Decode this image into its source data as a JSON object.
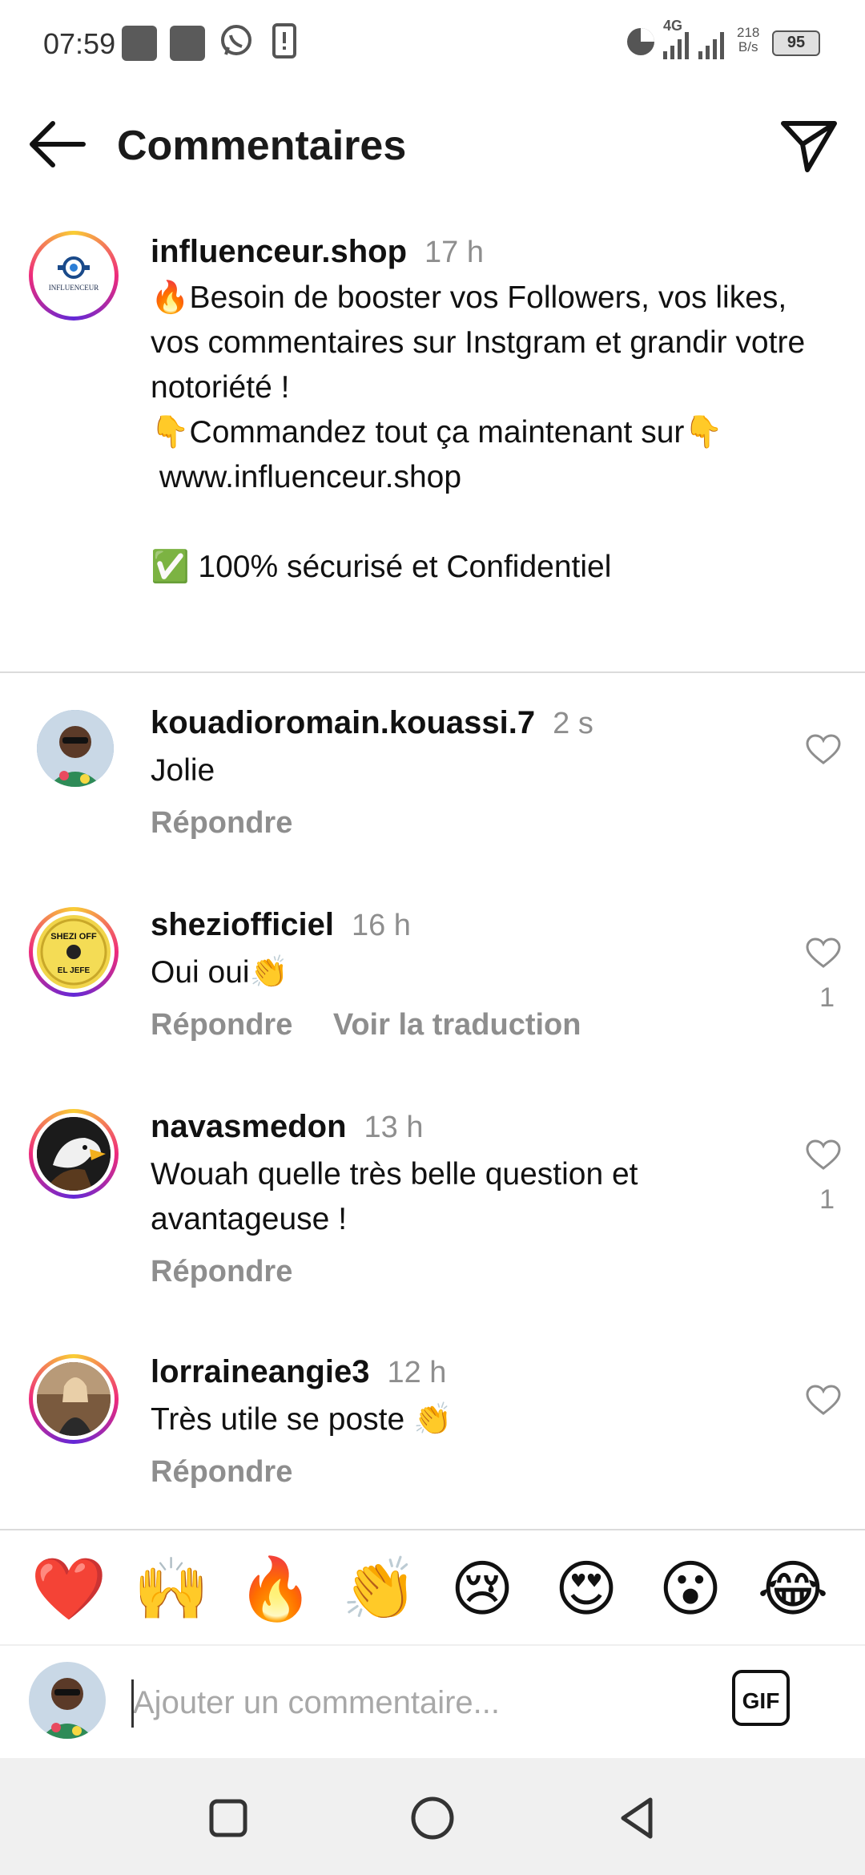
{
  "status_bar": {
    "time": "07:59",
    "network": "4G",
    "speed_value": "218",
    "speed_unit": "B/s",
    "battery": "95"
  },
  "header": {
    "title": "Commentaires"
  },
  "caption": {
    "username": "influenceur.shop",
    "time": "17 h",
    "avatar_logo_text": "INFLUENCEUR",
    "text": "🔥Besoin de booster vos Followers, vos likes, vos commentaires sur Instgram et grandir votre notoriété !\n👇Commandez tout ça maintenant sur👇\n www.influenceur.shop\n\n✅ 100% sécurisé et Confidentiel"
  },
  "comments": [
    {
      "username": "kouadioromain.kouassi.7",
      "time": "2 s",
      "text": "Jolie",
      "reply": "Répondre",
      "translate": "",
      "likes": ""
    },
    {
      "username": "sheziofficiel",
      "time": "16 h",
      "text": "Oui oui👏",
      "reply": "Répondre",
      "translate": "Voir la traduction",
      "likes": "1",
      "avatar_text_top": "SHEZI OFF",
      "avatar_text_bottom": "EL JEFE"
    },
    {
      "username": "navasmedon",
      "time": "13 h",
      "text": "Wouah quelle très belle question et avantageuse !",
      "reply": "Répondre",
      "translate": "",
      "likes": "1"
    },
    {
      "username": "lorraineangie3",
      "time": "12 h",
      "text": "Très utile se poste 👏",
      "reply": "Répondre",
      "translate": "",
      "likes": ""
    }
  ],
  "emoji_bar": [
    "❤️",
    "🙌",
    "🔥",
    "👏",
    "😢",
    "😍",
    "😮",
    "😂"
  ],
  "input": {
    "placeholder": "Ajouter un commentaire...",
    "gif_label": "GIF"
  },
  "icons": {
    "back": "arrow-left-icon",
    "send": "paper-plane-icon",
    "heart": "heart-outline-icon",
    "nav": [
      "square-icon",
      "circle-icon",
      "triangle-back-icon"
    ]
  }
}
